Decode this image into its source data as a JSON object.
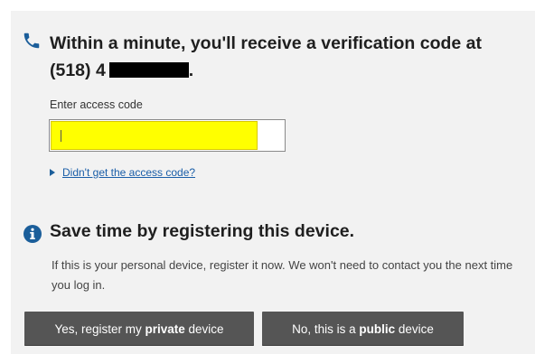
{
  "verification": {
    "headline_prefix": "Within a minute, you'll receive a verification code at",
    "phone_visible": "(518) 4",
    "input_label": "Enter access code",
    "input_value": "",
    "help_link": "Didn't get the access code?"
  },
  "register": {
    "title": "Save time by registering this device.",
    "description": "If this is your personal device, register it now. We won't need to contact you the next time you log in.",
    "private_button": {
      "pre": "Yes, register my ",
      "bold": "private",
      "post": " device"
    },
    "public_button": {
      "pre": "No, this is a ",
      "bold": "public",
      "post": " device"
    }
  },
  "colors": {
    "panel_bg": "#f2f2f2",
    "input_highlight": "#ffff00",
    "link": "#1a5ea8",
    "icon_blue": "#1b5e9a",
    "button_bg": "#555555"
  },
  "icons": {
    "phone": "phone-icon",
    "info": "info-icon",
    "expand": "triangle-right-icon"
  }
}
